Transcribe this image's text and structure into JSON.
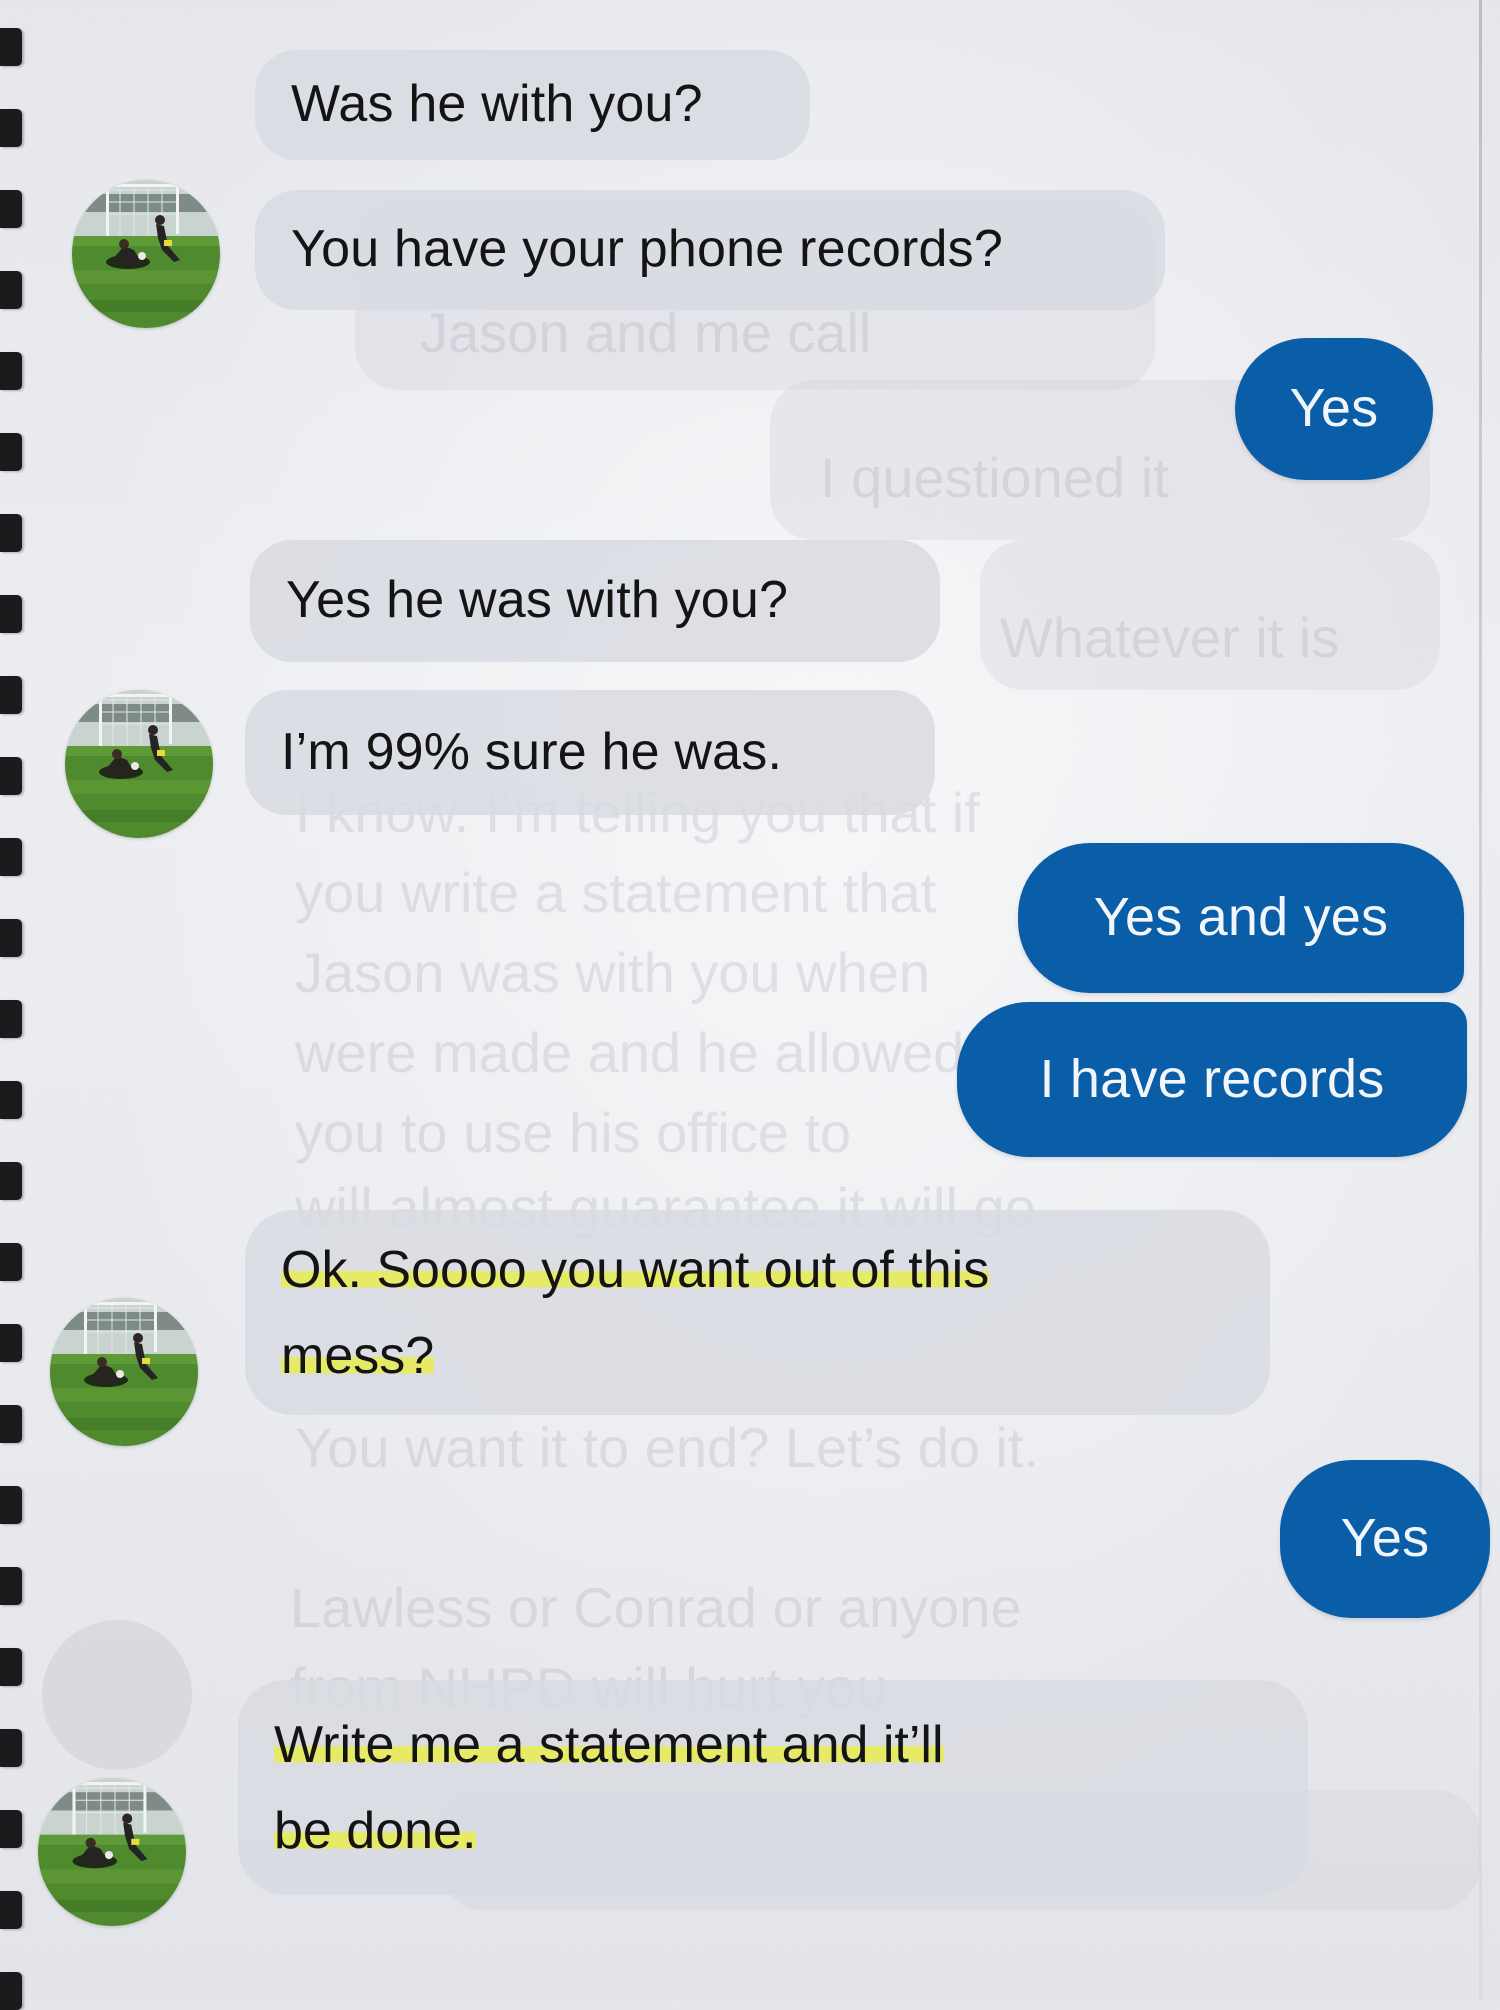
{
  "conversation": {
    "messages": [
      {
        "id": "m1",
        "direction": "incoming",
        "text": "Was he with you?"
      },
      {
        "id": "m2",
        "direction": "incoming",
        "text": "You have your phone records?"
      },
      {
        "id": "m3",
        "direction": "outgoing",
        "text": "Yes"
      },
      {
        "id": "m4",
        "direction": "incoming",
        "text": "Yes he was with you?"
      },
      {
        "id": "m5",
        "direction": "incoming",
        "text": "I’m 99% sure he was."
      },
      {
        "id": "m6",
        "direction": "outgoing",
        "text": "Yes and yes"
      },
      {
        "id": "m7",
        "direction": "outgoing",
        "text": "I have records"
      },
      {
        "id": "m8",
        "direction": "incoming",
        "lines": [
          "Ok. Soooo you want out of this",
          "mess?"
        ],
        "highlighted": true
      },
      {
        "id": "m9",
        "direction": "outgoing",
        "text": "Yes"
      },
      {
        "id": "m10",
        "direction": "incoming",
        "lines": [
          "Write me a statement and it’ll",
          "be done."
        ],
        "highlighted": true
      }
    ],
    "avatar": {
      "icon": "profile-photo-soccer-field",
      "description_colors": {
        "grass": "#4f8a2e",
        "sky": "#cfd8d4"
      }
    },
    "show_through_text": [
      "I know. I’m telling you that if",
      "you write a statement that",
      "Jason was with you when",
      "were made and he allowed",
      "you to use his office to",
      "will almost guarantee it will go",
      "You want it to end? Let’s do it.",
      "Lawless or Conrad or anyone",
      "from NHPD will hurt you",
      "I questioned it",
      "Whatever it is",
      "Jason and me call"
    ]
  },
  "colors": {
    "outgoing_bubble": "#0a5ea8",
    "incoming_bubble": "#d8dae2",
    "highlighter": "#eaee44",
    "binding": "#1b1b1d"
  }
}
